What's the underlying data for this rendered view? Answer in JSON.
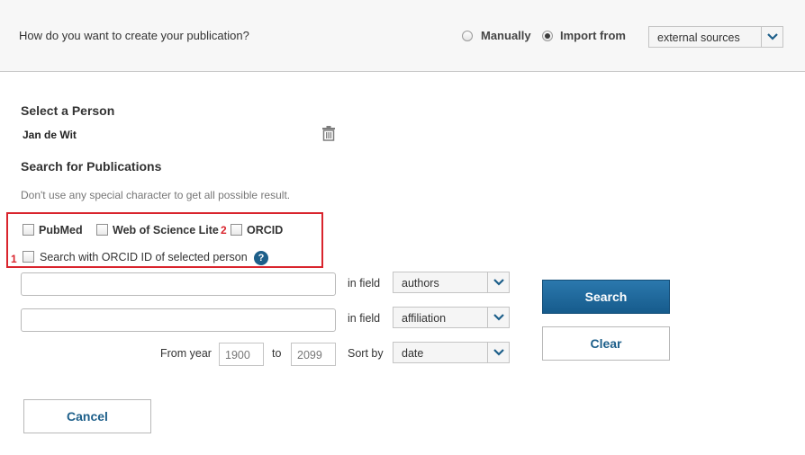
{
  "header": {
    "question": "How do you want to create your publication?",
    "options": [
      {
        "label": "Manually",
        "checked": false
      },
      {
        "label": "Import from",
        "checked": true
      }
    ],
    "source_select": "external sources"
  },
  "person_section": {
    "title": "Select a Person",
    "person_name": "Jan de Wit",
    "trash_icon": "trash-icon"
  },
  "search_section": {
    "title": "Search for Publications",
    "hint": "Don't use any special character to get all possible result.",
    "markers": [
      "1",
      "2"
    ],
    "marker_color": "#d9242d",
    "sources": [
      {
        "label": "PubMed",
        "checked": false
      },
      {
        "label": "Web of Science Lite",
        "checked": false
      },
      {
        "label": "ORCID",
        "checked": false
      }
    ],
    "orcid_checkbox": {
      "label": "Search with ORCID ID of selected person",
      "checked": false
    },
    "help_icon": "?"
  },
  "query": {
    "row1": {
      "value": "",
      "field_label": "in field",
      "field": "authors"
    },
    "row2": {
      "value": "",
      "field_label": "in field",
      "field": "affiliation"
    },
    "from_year_label": "From year",
    "from_year": "1900",
    "to_label": "to",
    "to_year": "2099",
    "sort_label": "Sort by",
    "sort": "date"
  },
  "buttons": {
    "search": "Search",
    "clear": "Clear",
    "cancel": "Cancel"
  },
  "colors": {
    "accent": "#1d5f8a",
    "primary_button": "#1f6a9c"
  }
}
